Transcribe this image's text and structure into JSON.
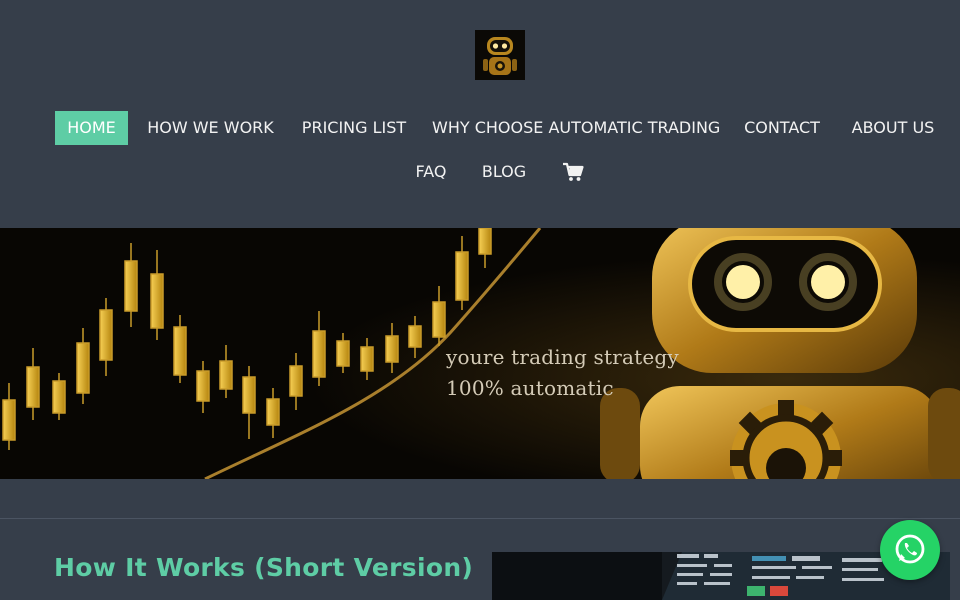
{
  "header": {
    "logo_icon": "robot-logo-icon",
    "nav": [
      {
        "label": "HOME",
        "active": true
      },
      {
        "label": "HOW WE WORK"
      },
      {
        "label": "PRICING LIST"
      },
      {
        "label": "WHY CHOOSE AUTOMATIC TRADING"
      },
      {
        "label": "CONTACT"
      },
      {
        "label": "ABOUT US"
      },
      {
        "label": "FAQ"
      },
      {
        "label": "BLOG"
      }
    ],
    "cart_icon": "shopping-cart-icon"
  },
  "hero": {
    "line1": "youre trading strategy",
    "line2": "100% automatic"
  },
  "section": {
    "title": "How It Works (Short Version)"
  },
  "floating": {
    "icon": "whatsapp-icon"
  },
  "colors": {
    "background": "#363e4a",
    "accent": "#5ecda5",
    "gold": "#d4a21c",
    "whatsapp": "#25d366"
  }
}
